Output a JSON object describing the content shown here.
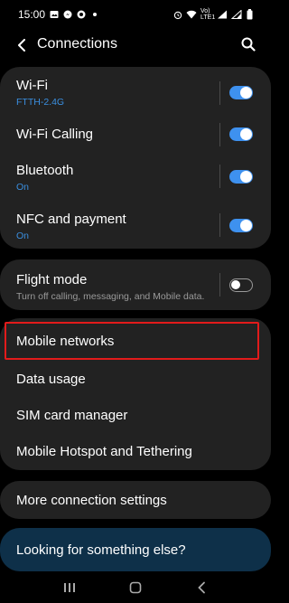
{
  "status_bar": {
    "time": "15:00",
    "network_label": "Vo) LTE1",
    "battery": "battery-icon"
  },
  "header": {
    "title": "Connections"
  },
  "connections": [
    {
      "title": "Wi-Fi",
      "subtitle": "FTTH-2.4G",
      "toggle": true
    },
    {
      "title": "Wi-Fi Calling",
      "subtitle": "",
      "toggle": true
    },
    {
      "title": "Bluetooth",
      "subtitle": "On",
      "toggle": true
    },
    {
      "title": "NFC and payment",
      "subtitle": "On",
      "toggle": true
    }
  ],
  "flight_mode": {
    "title": "Flight mode",
    "subtitle": "Turn off calling, messaging, and Mobile data.",
    "toggle": false
  },
  "network_items": [
    {
      "title": "Mobile networks"
    },
    {
      "title": "Data usage"
    },
    {
      "title": "SIM card manager"
    },
    {
      "title": "Mobile Hotspot and Tethering"
    }
  ],
  "more_settings": {
    "title": "More connection settings"
  },
  "suggestion": {
    "title": "Looking for something else?"
  },
  "colors": {
    "accent": "#3e91ef",
    "card": "#222222",
    "highlight": "#e21b1b",
    "suggestion_bg": "#0e3049"
  }
}
